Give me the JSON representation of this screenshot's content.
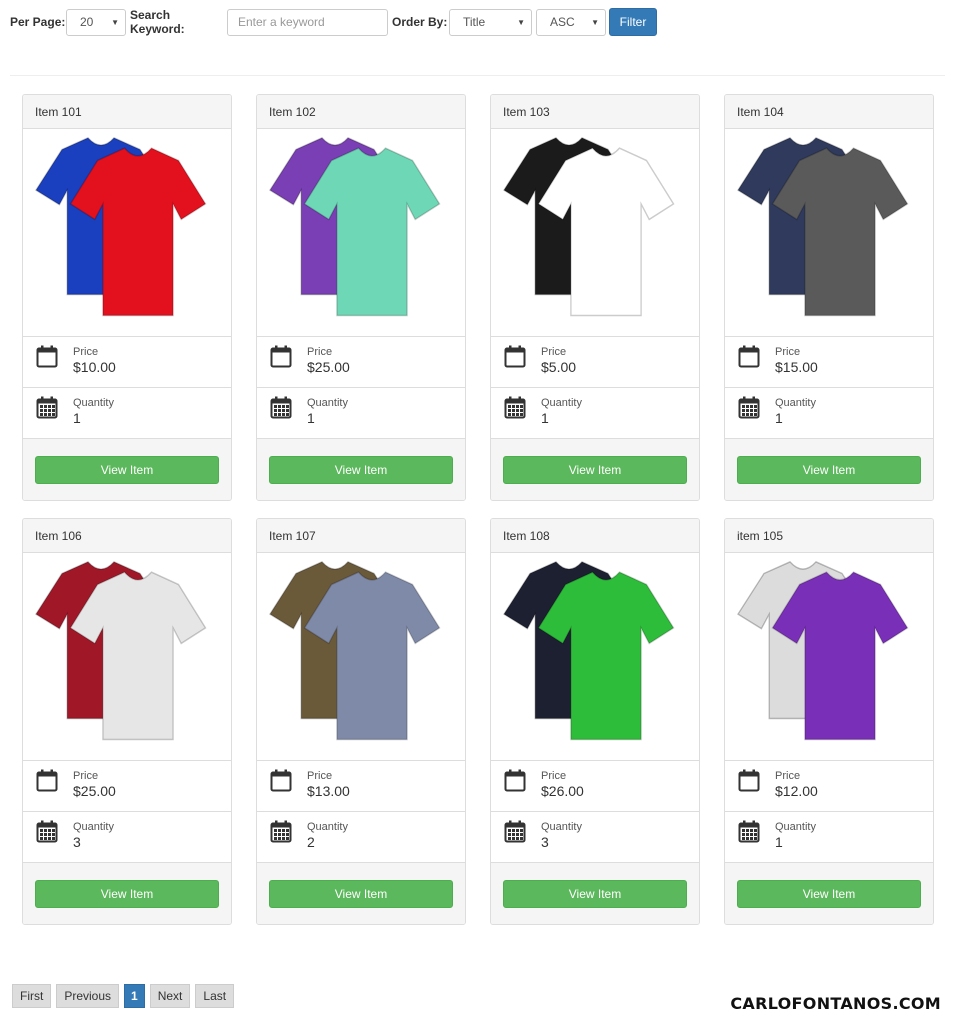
{
  "filter": {
    "per_page_label": "Per Page:",
    "per_page_value": "20",
    "search_label": "Search Keyword:",
    "search_placeholder": "Enter a keyword",
    "order_label": "Order By:",
    "order_value": "Title",
    "direction_value": "ASC",
    "filter_button": "Filter"
  },
  "labels": {
    "price": "Price",
    "quantity": "Quantity",
    "view_button": "View Item"
  },
  "items": [
    {
      "title": "Item 101",
      "price": "$10.00",
      "quantity": "1",
      "shirt_colors": [
        "#1a3fbf",
        "#e3101e"
      ],
      "icon": "tshirt-image"
    },
    {
      "title": "Item 102",
      "price": "$25.00",
      "quantity": "1",
      "shirt_colors": [
        "#7a3fb5",
        "#6ed8b6"
      ],
      "icon": "tshirt-image"
    },
    {
      "title": "Item 103",
      "price": "$5.00",
      "quantity": "1",
      "shirt_colors": [
        "#1b1b1b",
        "#ffffff"
      ],
      "icon": "tshirt-image"
    },
    {
      "title": "Item 104",
      "price": "$15.00",
      "quantity": "1",
      "shirt_colors": [
        "#2f3a5c",
        "#5a5a5a"
      ],
      "icon": "tshirt-image"
    },
    {
      "title": "Item 106",
      "price": "$25.00",
      "quantity": "3",
      "shirt_colors": [
        "#a01828",
        "#e6e6e6"
      ],
      "icon": "tshirt-image"
    },
    {
      "title": "Item 107",
      "price": "$13.00",
      "quantity": "2",
      "shirt_colors": [
        "#6b5a3a",
        "#7f8aa8"
      ],
      "icon": "tshirt-image"
    },
    {
      "title": "Item 108",
      "price": "$26.00",
      "quantity": "3",
      "shirt_colors": [
        "#1c2030",
        "#2ebd3a"
      ],
      "icon": "tshirt-image"
    },
    {
      "title": "item 105",
      "price": "$12.00",
      "quantity": "1",
      "shirt_colors": [
        "#dcdcdc",
        "#7a2fb8"
      ],
      "icon": "tshirt-image"
    }
  ],
  "pagination": {
    "first": "First",
    "previous": "Previous",
    "current": "1",
    "next": "Next",
    "last": "Last"
  },
  "brand": "CARLOFONTANOS.COM"
}
